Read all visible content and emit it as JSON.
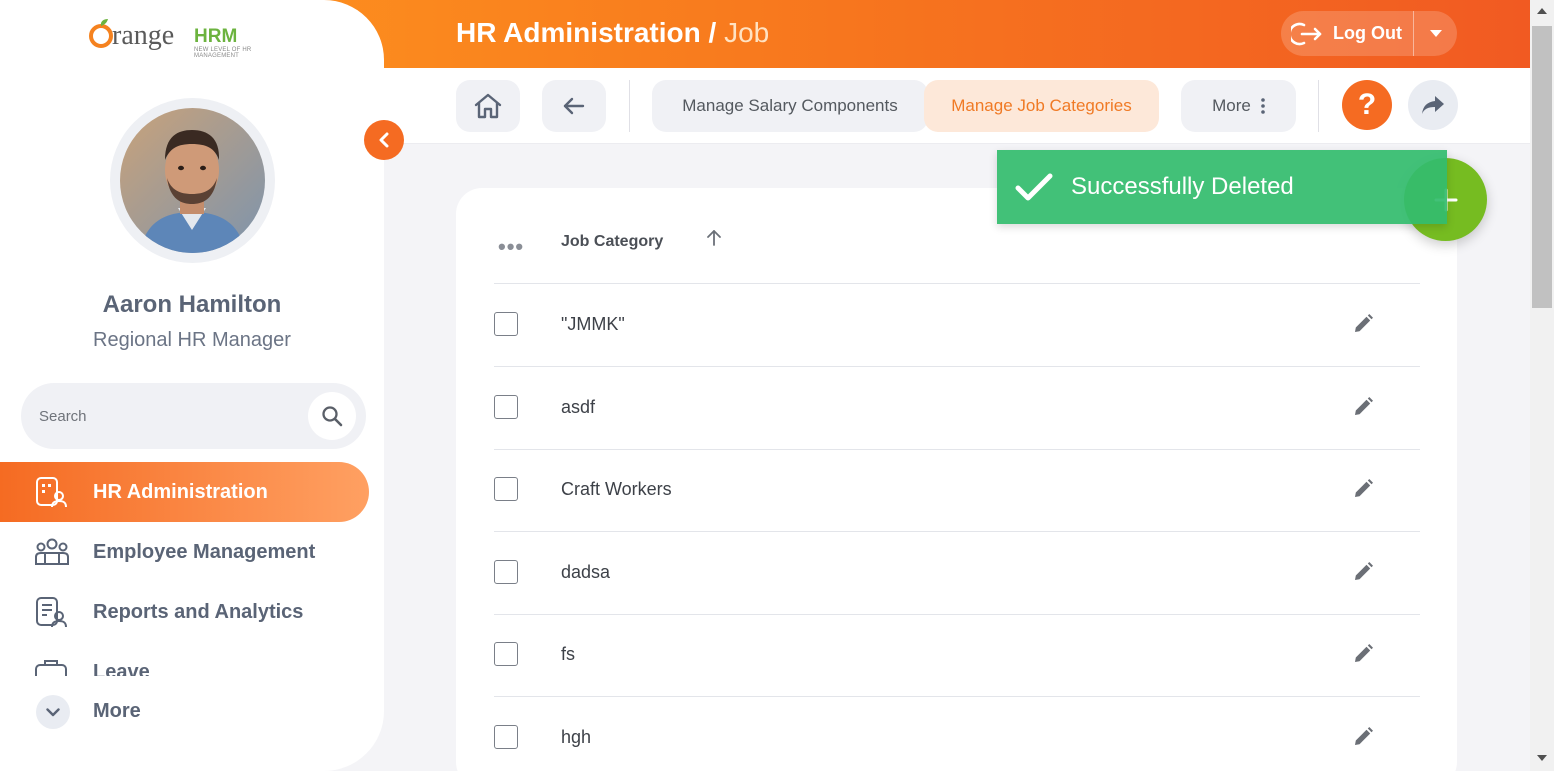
{
  "header": {
    "title": "HR Administration",
    "separator": " / ",
    "subtitle": "Job",
    "logout_label": "Log Out"
  },
  "toolbar": {
    "tabs": [
      {
        "label": "Manage Salary Components",
        "active": false
      },
      {
        "label": "Manage Job Categories",
        "active": true
      },
      {
        "label": "More",
        "active": false
      }
    ],
    "help_label": "?"
  },
  "sidebar": {
    "logo_text": "range",
    "logo_hrm": "HRM",
    "logo_tagline": "NEW LEVEL OF HR MANAGEMENT",
    "user_name": "Aaron Hamilton",
    "user_role": "Regional HR Manager",
    "search_placeholder": "Search",
    "items": [
      {
        "label": "HR Administration",
        "icon": "hr-admin-icon",
        "active": true
      },
      {
        "label": "Employee Management",
        "icon": "employees-icon",
        "active": false
      },
      {
        "label": "Reports and Analytics",
        "icon": "reports-icon",
        "active": false
      },
      {
        "label": "Leave",
        "icon": "leave-icon",
        "active": false
      }
    ],
    "more_label": "More"
  },
  "table": {
    "column_header": "Job Category",
    "sort": "ascending",
    "rows": [
      "\"JMMK\"",
      "asdf",
      "Craft Workers",
      "dadsa",
      "fs",
      "hgh"
    ]
  },
  "toast": {
    "message": "Successfully Deleted",
    "color": "#34bc6e"
  },
  "colors": {
    "accent": "#f56b22",
    "add_button": "#76bc21"
  }
}
